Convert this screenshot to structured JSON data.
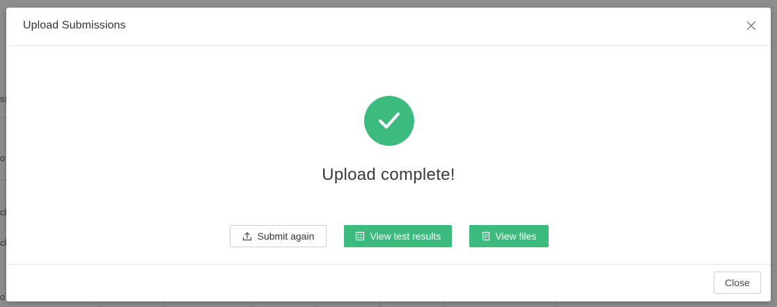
{
  "background": {
    "fragments": [
      "ss",
      "o",
      "ck",
      "ck",
      "o"
    ]
  },
  "modal": {
    "title": "Upload Submissions",
    "status_text": "Upload complete!",
    "actions": {
      "submit_again_label": "Submit again",
      "view_test_results_label": "View test results",
      "view_files_label": "View files"
    },
    "footer": {
      "close_label": "Close"
    }
  },
  "icons": {
    "close": "close-icon",
    "success": "checkmark-icon",
    "upload": "upload-icon",
    "results": "test-results-icon",
    "files": "document-icon"
  },
  "colors": {
    "accent": "#3dbb7f",
    "overlay": "#8d8d8d"
  }
}
